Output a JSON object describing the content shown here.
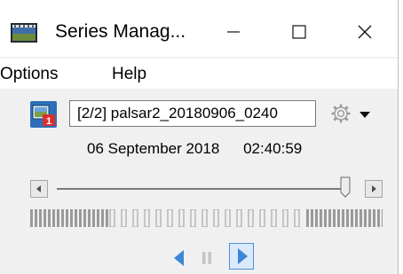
{
  "window": {
    "title": "Series Manag...",
    "minimize_icon": "minimize-icon",
    "maximize_icon": "maximize-icon",
    "close_icon": "close-icon"
  },
  "menu": {
    "items": [
      {
        "label": "Options"
      },
      {
        "label": "Help"
      }
    ]
  },
  "series": {
    "selected": "[2/2] palsar2_20180906_0240",
    "date": "06 September 2018",
    "time": "02:40:59",
    "icon": "series-image-icon",
    "settings_icon": "gear-icon",
    "dropdown_icon": "chevron-down-icon"
  },
  "slider": {
    "position_fraction": 1.0
  },
  "playback": {
    "prev_icon": "play-reverse-icon",
    "pause_icon": "pause-icon",
    "next_icon": "play-forward-icon"
  },
  "colors": {
    "accent": "#3b86d6",
    "timeline_bar": "#9a9a9a",
    "window_bg": "#f0f0f0"
  }
}
